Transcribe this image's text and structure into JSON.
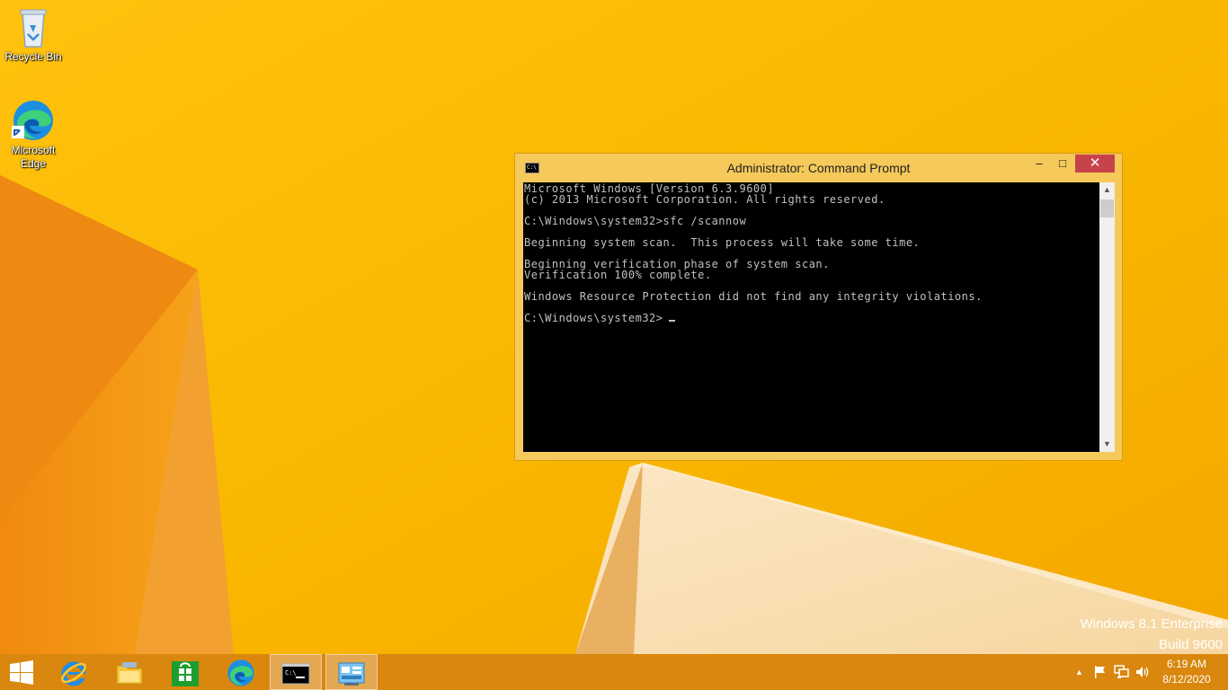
{
  "desktop": {
    "icons": [
      {
        "label": "Recycle Bin",
        "icon": "recycle-bin-icon"
      },
      {
        "label": "Microsoft Edge",
        "icon": "edge-icon"
      }
    ],
    "watermark": {
      "line1": "Windows 8.1 Enterprise",
      "line2": "Build 9600"
    }
  },
  "window": {
    "title": "Administrator: Command Prompt",
    "icon": "cmd-icon",
    "title_icon_text": "C:\\",
    "controls": {
      "minimize": "–",
      "maximize": "□",
      "close": "✕"
    },
    "console_lines": [
      "Microsoft Windows [Version 6.3.9600]",
      "(c) 2013 Microsoft Corporation. All rights reserved.",
      "",
      "C:\\Windows\\system32>sfc /scannow",
      "",
      "Beginning system scan.  This process will take some time.",
      "",
      "Beginning verification phase of system scan.",
      "Verification 100% complete.",
      "",
      "Windows Resource Protection did not find any integrity violations.",
      "",
      "C:\\Windows\\system32>"
    ],
    "scroll": {
      "up": "▲",
      "down": "▼"
    }
  },
  "taskbar": {
    "items": [
      {
        "name": "start-button",
        "icon": "windows-logo-icon"
      },
      {
        "name": "internet-explorer",
        "icon": "ie-icon"
      },
      {
        "name": "file-explorer",
        "icon": "folder-icon"
      },
      {
        "name": "store",
        "icon": "store-icon"
      },
      {
        "name": "edge",
        "icon": "edge-icon"
      },
      {
        "name": "command-prompt",
        "icon": "cmd-icon",
        "active": true
      },
      {
        "name": "control-panel",
        "icon": "control-panel-icon",
        "active": true
      }
    ],
    "tray": {
      "chevron": "▲",
      "clock_time": "6:19 AM",
      "clock_date": "8/12/2020"
    }
  },
  "colors": {
    "wallpaper": "#f8b400",
    "taskbar": "#d9870e",
    "window_frame": "#f5c95a",
    "close_button": "#c7434a",
    "console_bg": "#000000",
    "console_text": "#c0c0c0"
  }
}
